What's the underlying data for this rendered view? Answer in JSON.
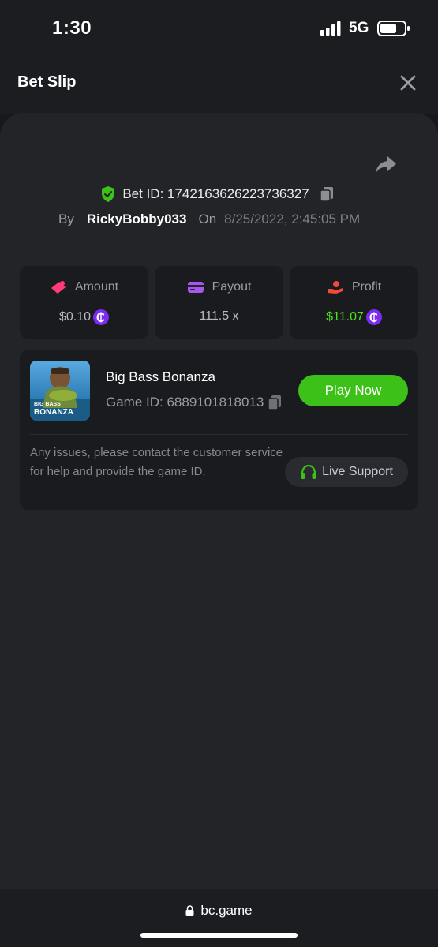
{
  "status_bar": {
    "time": "1:30",
    "network": "5G",
    "icons": [
      "signal-icon",
      "battery-icon"
    ]
  },
  "header": {
    "title": "Bet Slip",
    "close_icon": "close-icon"
  },
  "bet": {
    "bet_id_text": "Bet ID: 1742163626223736327",
    "by_label": "By",
    "username": "RickyBobby033",
    "on_label": "On",
    "date": "8/25/2022, 2:45:05 PM"
  },
  "stats": [
    {
      "label": "Amount",
      "value": "$0.10",
      "icon": "amount-icon",
      "icon_color": "#ff3b7a"
    },
    {
      "label": "Payout",
      "value": "111.5 x",
      "icon": "payout-card-icon",
      "icon_color": "#a557f0"
    },
    {
      "label": "Profit",
      "value": "$11.07",
      "icon": "profit-icon",
      "icon_color": "#f04a3a"
    }
  ],
  "game": {
    "name": "Big Bass Bonanza",
    "game_id_text": "Game ID: 6889101818013",
    "thumbnail_text": [
      "BIG BASS",
      "BONANZA"
    ],
    "play_label": "Play Now",
    "support_text": "Any issues, please contact the customer service for help and provide the game ID.",
    "support_label": "Live Support"
  },
  "url_bar": {
    "domain": "bc.game"
  },
  "colors": {
    "background": "#17181b",
    "panel": "#232428",
    "card": "#1a1b1f",
    "accent_green": "#3bc117",
    "profit_green": "#4ee01a",
    "coin_purple": "#7b2cf0"
  }
}
